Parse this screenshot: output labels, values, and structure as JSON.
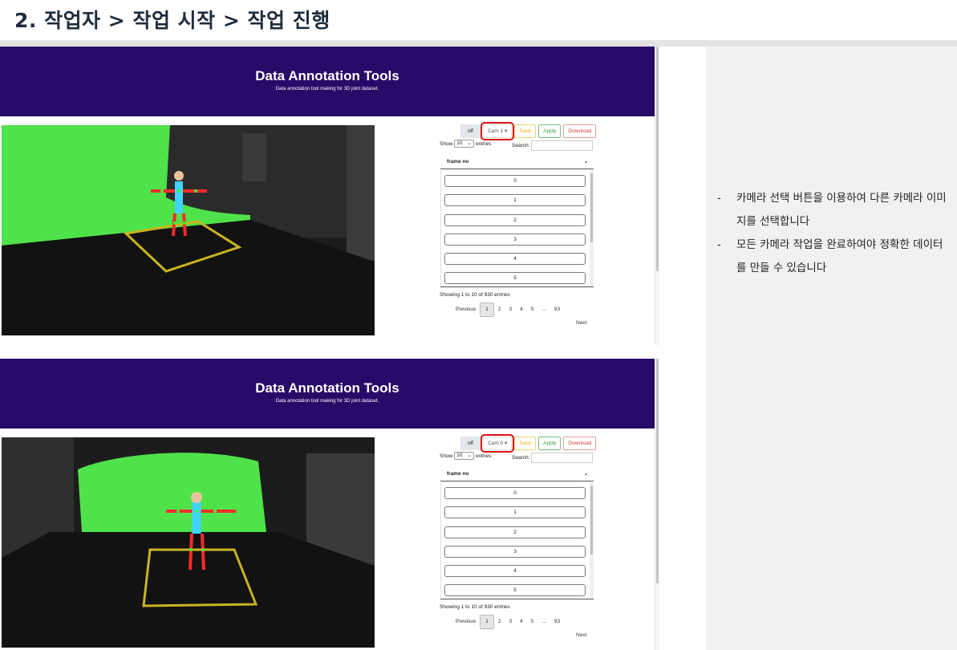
{
  "page": {
    "title": "2. 작업자 > 작업 시작 > 작업 진행"
  },
  "notes": [
    "카메라 선택 버튼을 이용하여 다른 카메라 이미지를 선택합니다",
    "모든 카메라 작업을 완료하여야 정확한 데이터를 만들 수 있습니다"
  ],
  "screens": [
    {
      "banner_title": "Data Annotation Tools",
      "banner_subtitle": "Data annotation tool making for 3D joint dataset.",
      "controls": {
        "off": "off",
        "camera": "Cam 1 ▾",
        "save": "Save",
        "apply": "Apply",
        "download": "Download"
      },
      "show_label": "Show",
      "page_length": "10",
      "entries_label": "entries",
      "search_label": "Search:",
      "column_header": "frame no",
      "rows": [
        "0",
        "1",
        "2",
        "3",
        "4",
        "5"
      ],
      "info": "Showing 1 to 10 of 930 entries",
      "pagination": {
        "previous": "Previous",
        "pages": [
          "1",
          "2",
          "3",
          "4",
          "5",
          "...",
          "93"
        ],
        "next": "Next"
      }
    },
    {
      "banner_title": "Data Annotation Tools",
      "banner_subtitle": "Data annotation tool making for 3D joint dataset.",
      "controls": {
        "off": "off",
        "camera": "Cam 0 ▾",
        "save": "Save",
        "apply": "Apply",
        "download": "Download"
      },
      "show_label": "Show",
      "page_length": "10",
      "entries_label": "entries",
      "search_label": "Search:",
      "column_header": "frame no",
      "rows": [
        "0",
        "1",
        "2",
        "3",
        "4",
        "5"
      ],
      "info": "Showing 1 to 10 of 930 entries",
      "pagination": {
        "previous": "Previous",
        "pages": [
          "1",
          "2",
          "3",
          "4",
          "5",
          "...",
          "93"
        ],
        "next": "Next"
      }
    }
  ],
  "colors": {
    "banner": "#280b68",
    "highlight": "#e01010",
    "save": "#e8b100",
    "apply": "#2f9a3e",
    "download": "#d43a3a",
    "right_panel": "#f1f1f1"
  },
  "icons": {
    "sort": "sort-asc-icon",
    "dropdown": "chevron-down-icon"
  }
}
